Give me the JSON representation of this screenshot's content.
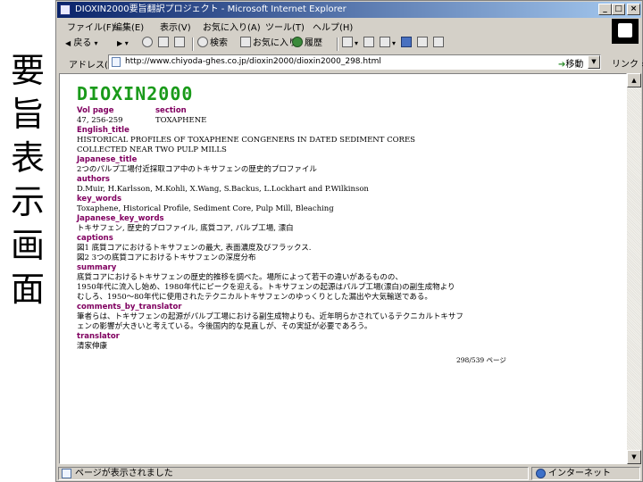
{
  "side_caption": [
    "要",
    "旨",
    "表",
    "示",
    "画",
    "面"
  ],
  "window": {
    "title": "DIOXIN2000要旨翻訳プロジェクト - Microsoft Internet Explorer",
    "minimize": "_",
    "maximize": "□",
    "close": "×"
  },
  "menu": [
    "ファイル(F)",
    "編集(E)",
    "表示(V)",
    "お気に入り(A)",
    "ツール(T)",
    "ヘルプ(H)"
  ],
  "toolbar": {
    "back": "戻る",
    "search": "検索",
    "favorites": "お気に入り",
    "history": "履歴"
  },
  "address": {
    "label": "アドレス(D)",
    "url": "http://www.chiyoda-ghes.co.jp/dioxin2000/dioxin2000_298.html",
    "go": "移動",
    "links": "リンク »"
  },
  "document": {
    "title": "DIOXIN2000",
    "header_labels": [
      "Vol page",
      "section"
    ],
    "header_values": [
      "47, 256-259",
      "TOXAPHENE"
    ],
    "fields": [
      {
        "label": "English_title",
        "lines": [
          "HISTORICAL PROFILES OF TOXAPHENE CONGENERS IN DATED SEDIMENT CORES",
          "COLLECTED NEAR TWO PULP MILLS"
        ]
      },
      {
        "label": "Japanese_title",
        "lines": [
          "2つのパルプ工場付近採取コア中のトキサフェンの歴史的プロファイル"
        ]
      },
      {
        "label": "authors",
        "lines": [
          "D.Muir, H.Karlsson, M.Kohli, X.Wang, S.Backus, L.Lockhart and P.Wilkinson"
        ]
      },
      {
        "label": "key_words",
        "lines": [
          "Toxaphene, Historical Profile, Sediment Core, Pulp Mill, Bleaching"
        ]
      },
      {
        "label": "Japanese_key_words",
        "lines": [
          "トキサフェン, 歴史的プロファイル, 底質コア, パルプ工場, 漂白"
        ]
      },
      {
        "label": "captions",
        "lines": [
          "図1 底質コアにおけるトキサフェンの最大, 表面濃度及びフラックス.",
          "図2 3つの底質コアにおけるトキサフェンの深度分布"
        ]
      },
      {
        "label": "summary",
        "lines": [
          "底質コアにおけるトキサフェンの歴史的推移を調べた。場所によって若干の違いがあるものの、",
          "1950年代に流入し始め、1980年代にピークを迎える。トキサフェンの起源はパルプ工場(漂白)の副生成物より",
          "むしろ、1950～80年代に使用されたテクニカルトキサフェンのゆっくりとした漏出や大気輸送である。"
        ]
      },
      {
        "label": "comments_by_translator",
        "lines": [
          "筆者らは、トキサフェンの起源がパルプ工場における副生成物よりも、近年明らかされているテクニカルトキサフ",
          "ェンの影響が大きいと考えている。今後国内的な見直しが、その実証が必要であろう。"
        ]
      },
      {
        "label": "translator",
        "lines": [
          "清家伸康"
        ]
      }
    ],
    "page_counter": "298/539 ページ"
  },
  "status": {
    "message": "ページが表示されました",
    "zone": "インターネット"
  }
}
